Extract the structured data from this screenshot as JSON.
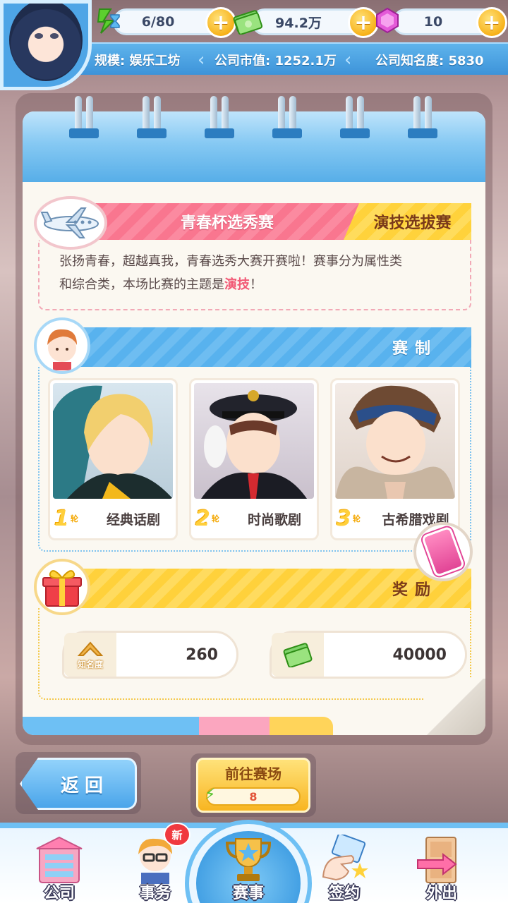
{
  "status_bar": {
    "energy": "6/80",
    "money": "94.2万",
    "gems": "10",
    "scale_label": "规模: 娱乐工坊",
    "market_value_label": "公司市值: 1252.1万",
    "fame_label": "公司知名度: 5830"
  },
  "event": {
    "title": "青春杯选秀赛",
    "tag": "演技选拔赛",
    "description_line1": "张扬青春，超越真我，青春选秀大赛开赛啦！赛事分为属性类",
    "description_line2_prefix": "和综合类，本场比赛的主题是",
    "description_theme": "演技",
    "description_line2_suffix": "！"
  },
  "format": {
    "header": "赛制",
    "rounds": [
      {
        "rank": "1",
        "rank_suffix": "轮",
        "name": "经典话剧"
      },
      {
        "rank": "2",
        "rank_suffix": "轮",
        "name": "时尚歌剧"
      },
      {
        "rank": "3",
        "rank_suffix": "轮",
        "name": "古希腊戏剧"
      }
    ]
  },
  "reward": {
    "header": "奖励",
    "fame_icon_label": "知名度",
    "fame_value": "260",
    "money_value": "40000"
  },
  "actions": {
    "back_label": "返回",
    "go_label": "前往赛场",
    "go_cost": "8"
  },
  "nav": {
    "items": [
      {
        "label": "公司",
        "icon": "building-icon"
      },
      {
        "label": "事务",
        "icon": "manager-icon",
        "badge": "新"
      },
      {
        "label": "赛事",
        "icon": "trophy-icon"
      },
      {
        "label": "签约",
        "icon": "contract-icon"
      },
      {
        "label": "外出",
        "icon": "door-icon"
      }
    ]
  },
  "colors": {
    "accent_blue": "#4ea5e6",
    "accent_pink": "#f9768f",
    "accent_yellow": "#ffd13b",
    "highlight": "#f25a76"
  }
}
